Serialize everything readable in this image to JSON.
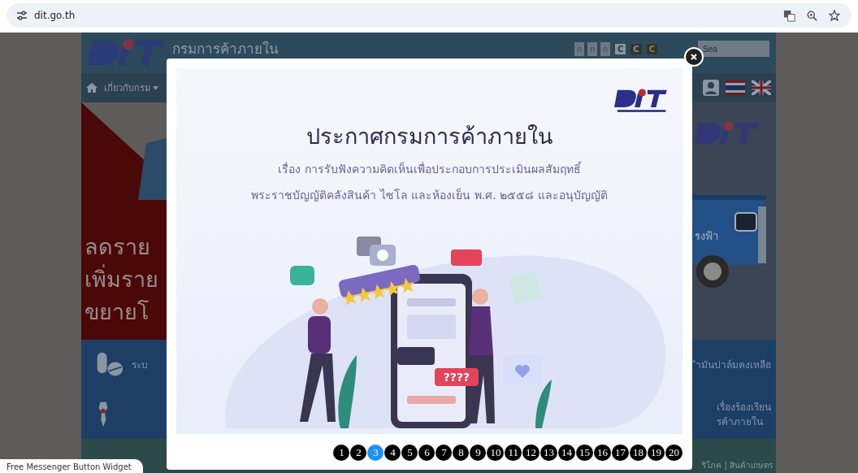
{
  "browser": {
    "url": "dit.go.th"
  },
  "site": {
    "org_name": "กรมการค้าภายใน",
    "search": {
      "placeholder": "Sea"
    },
    "font_size_buttons": [
      "ก",
      "ก",
      "ก"
    ],
    "contrast_buttons": [
      "C",
      "C",
      "C"
    ],
    "nav_item": "เกี่ยวกับกรม",
    "banner_lines": [
      "ลดราย",
      "เพิ่มราย",
      "ขยายโ"
    ],
    "truck_sign": "รงฟ้า",
    "services": [
      {
        "left": "ระบ",
        "right": "ำมันปาล์มคงเหลือ"
      },
      {
        "right": "เรื่องร้องเรียน\nรค้าภายใน"
      }
    ],
    "footer_right": "ริโภค | สินค้าเกษตร"
  },
  "messenger_widget": "Free Messenger Button Widget",
  "modal": {
    "title": "ประกาศกรมการค้าภายใน",
    "subtitle_lines": [
      "เรื่อง การรับฟังความคิดเห็นเพื่อประกอบการประเมินผลสัมฤทธิ์",
      "พระราชบัญญัติคลังสินค้า ไซโล และห้องเย็น พ.ศ. ๒๕๕๘ และอนุบัญญัติ"
    ],
    "bubble_text": "????",
    "pages": [
      {
        "label": "1",
        "selected": false
      },
      {
        "label": "2",
        "selected": false
      },
      {
        "label": "3",
        "selected": true
      },
      {
        "label": "4",
        "selected": false
      },
      {
        "label": "5",
        "selected": false
      },
      {
        "label": "6",
        "selected": false
      },
      {
        "label": "7",
        "selected": false
      },
      {
        "label": "8",
        "selected": false
      },
      {
        "label": "9",
        "selected": false
      },
      {
        "label": "10",
        "selected": false
      },
      {
        "label": "11",
        "selected": false
      },
      {
        "label": "12",
        "selected": false
      },
      {
        "label": "13",
        "selected": false
      },
      {
        "label": "14",
        "selected": false
      },
      {
        "label": "15",
        "selected": false
      },
      {
        "label": "16",
        "selected": false
      },
      {
        "label": "17",
        "selected": false
      },
      {
        "label": "18",
        "selected": false
      },
      {
        "label": "19",
        "selected": false
      },
      {
        "label": "20",
        "selected": false
      }
    ]
  }
}
